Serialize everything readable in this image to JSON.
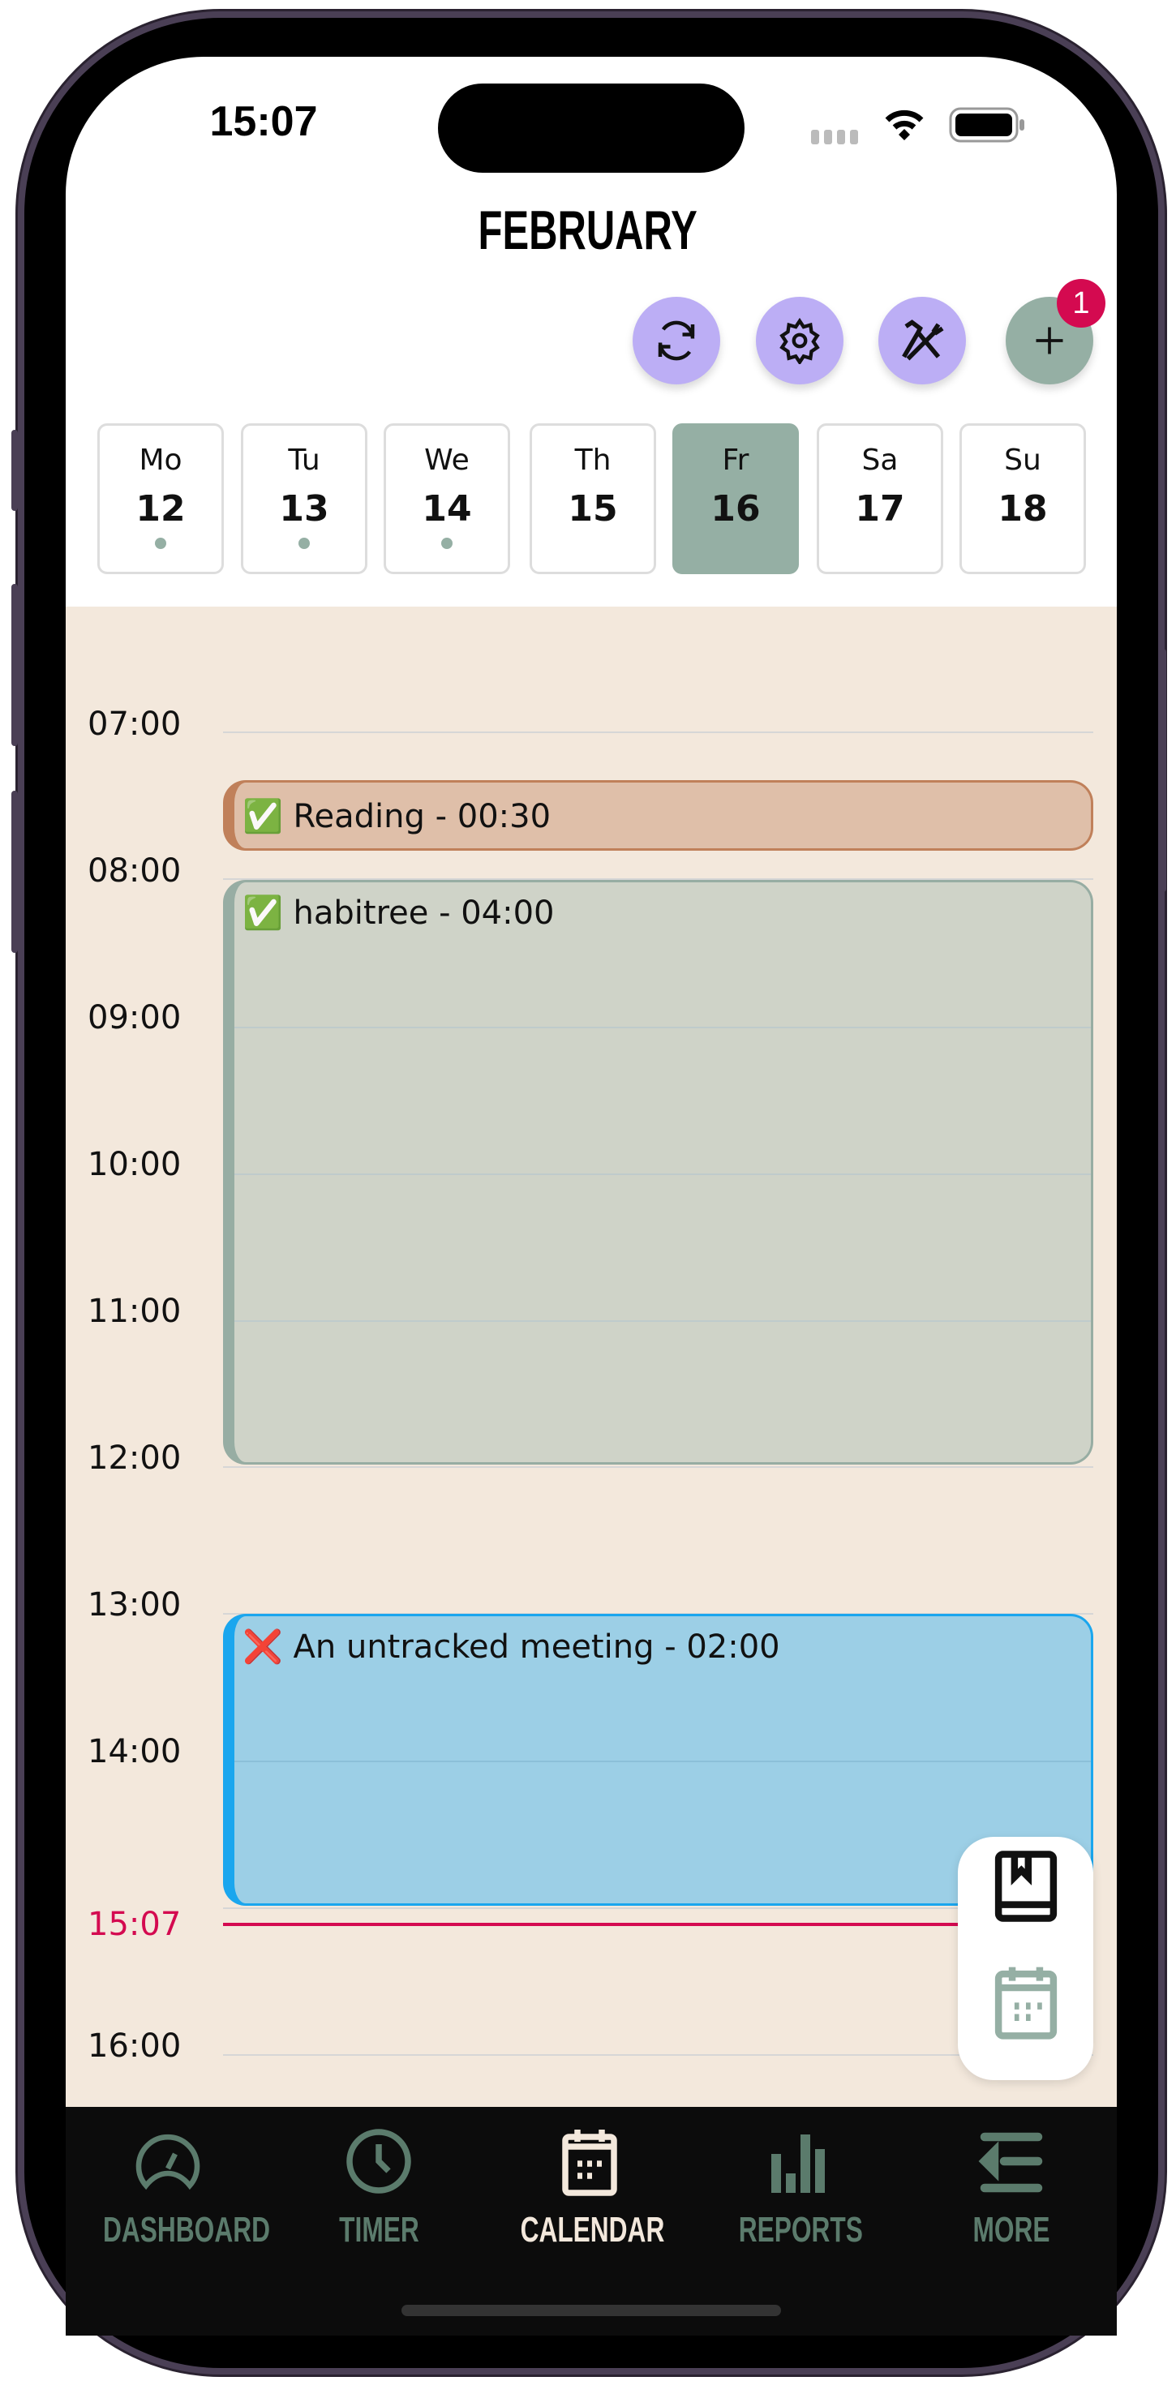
{
  "status_bar": {
    "time": "15:07"
  },
  "header": {
    "title": "FEBRUARY",
    "badge_count": "1"
  },
  "actions": [
    {
      "icon": "sync-icon"
    },
    {
      "icon": "gear-icon"
    },
    {
      "icon": "tools-icon"
    },
    {
      "icon": "plus-icon"
    }
  ],
  "week": [
    {
      "dow": "Mo",
      "day": "12",
      "has_events": true
    },
    {
      "dow": "Tu",
      "day": "13",
      "has_events": true
    },
    {
      "dow": "We",
      "day": "14",
      "has_events": true
    },
    {
      "dow": "Th",
      "day": "15",
      "has_events": false
    },
    {
      "dow": "Fr",
      "day": "16",
      "has_events": false,
      "selected": true
    },
    {
      "dow": "Sa",
      "day": "17",
      "has_events": false
    },
    {
      "dow": "Su",
      "day": "18",
      "has_events": false
    }
  ],
  "hours": [
    "07:00",
    "08:00",
    "09:00",
    "10:00",
    "11:00",
    "12:00",
    "13:00",
    "14:00",
    "16:00"
  ],
  "current_time": "15:07",
  "events": [
    {
      "status_icon": "✅",
      "label": "Reading - 00:30",
      "color": "#dfbfa9",
      "border": "#c0805a"
    },
    {
      "status_icon": "✅",
      "label": "habitree - 04:00",
      "color": "#cfd3c8",
      "border": "#97ada3"
    },
    {
      "status_icon": "❌",
      "label": "An untracked meeting - 02:00",
      "color": "#9ccfe6",
      "border": "#1aa6ee"
    }
  ],
  "colors": {
    "accent": "#95afa4",
    "action": "#bcaef5",
    "now": "#d40a50",
    "calendar_bg": "#f3e8dc"
  },
  "tabs": [
    {
      "label": "DASHBOARD",
      "icon": "dashboard-icon"
    },
    {
      "label": "TIMER",
      "icon": "clock-icon"
    },
    {
      "label": "CALENDAR",
      "icon": "calendar-icon",
      "active": true
    },
    {
      "label": "REPORTS",
      "icon": "bar-chart-icon"
    },
    {
      "label": "MORE",
      "icon": "menu-icon"
    }
  ]
}
